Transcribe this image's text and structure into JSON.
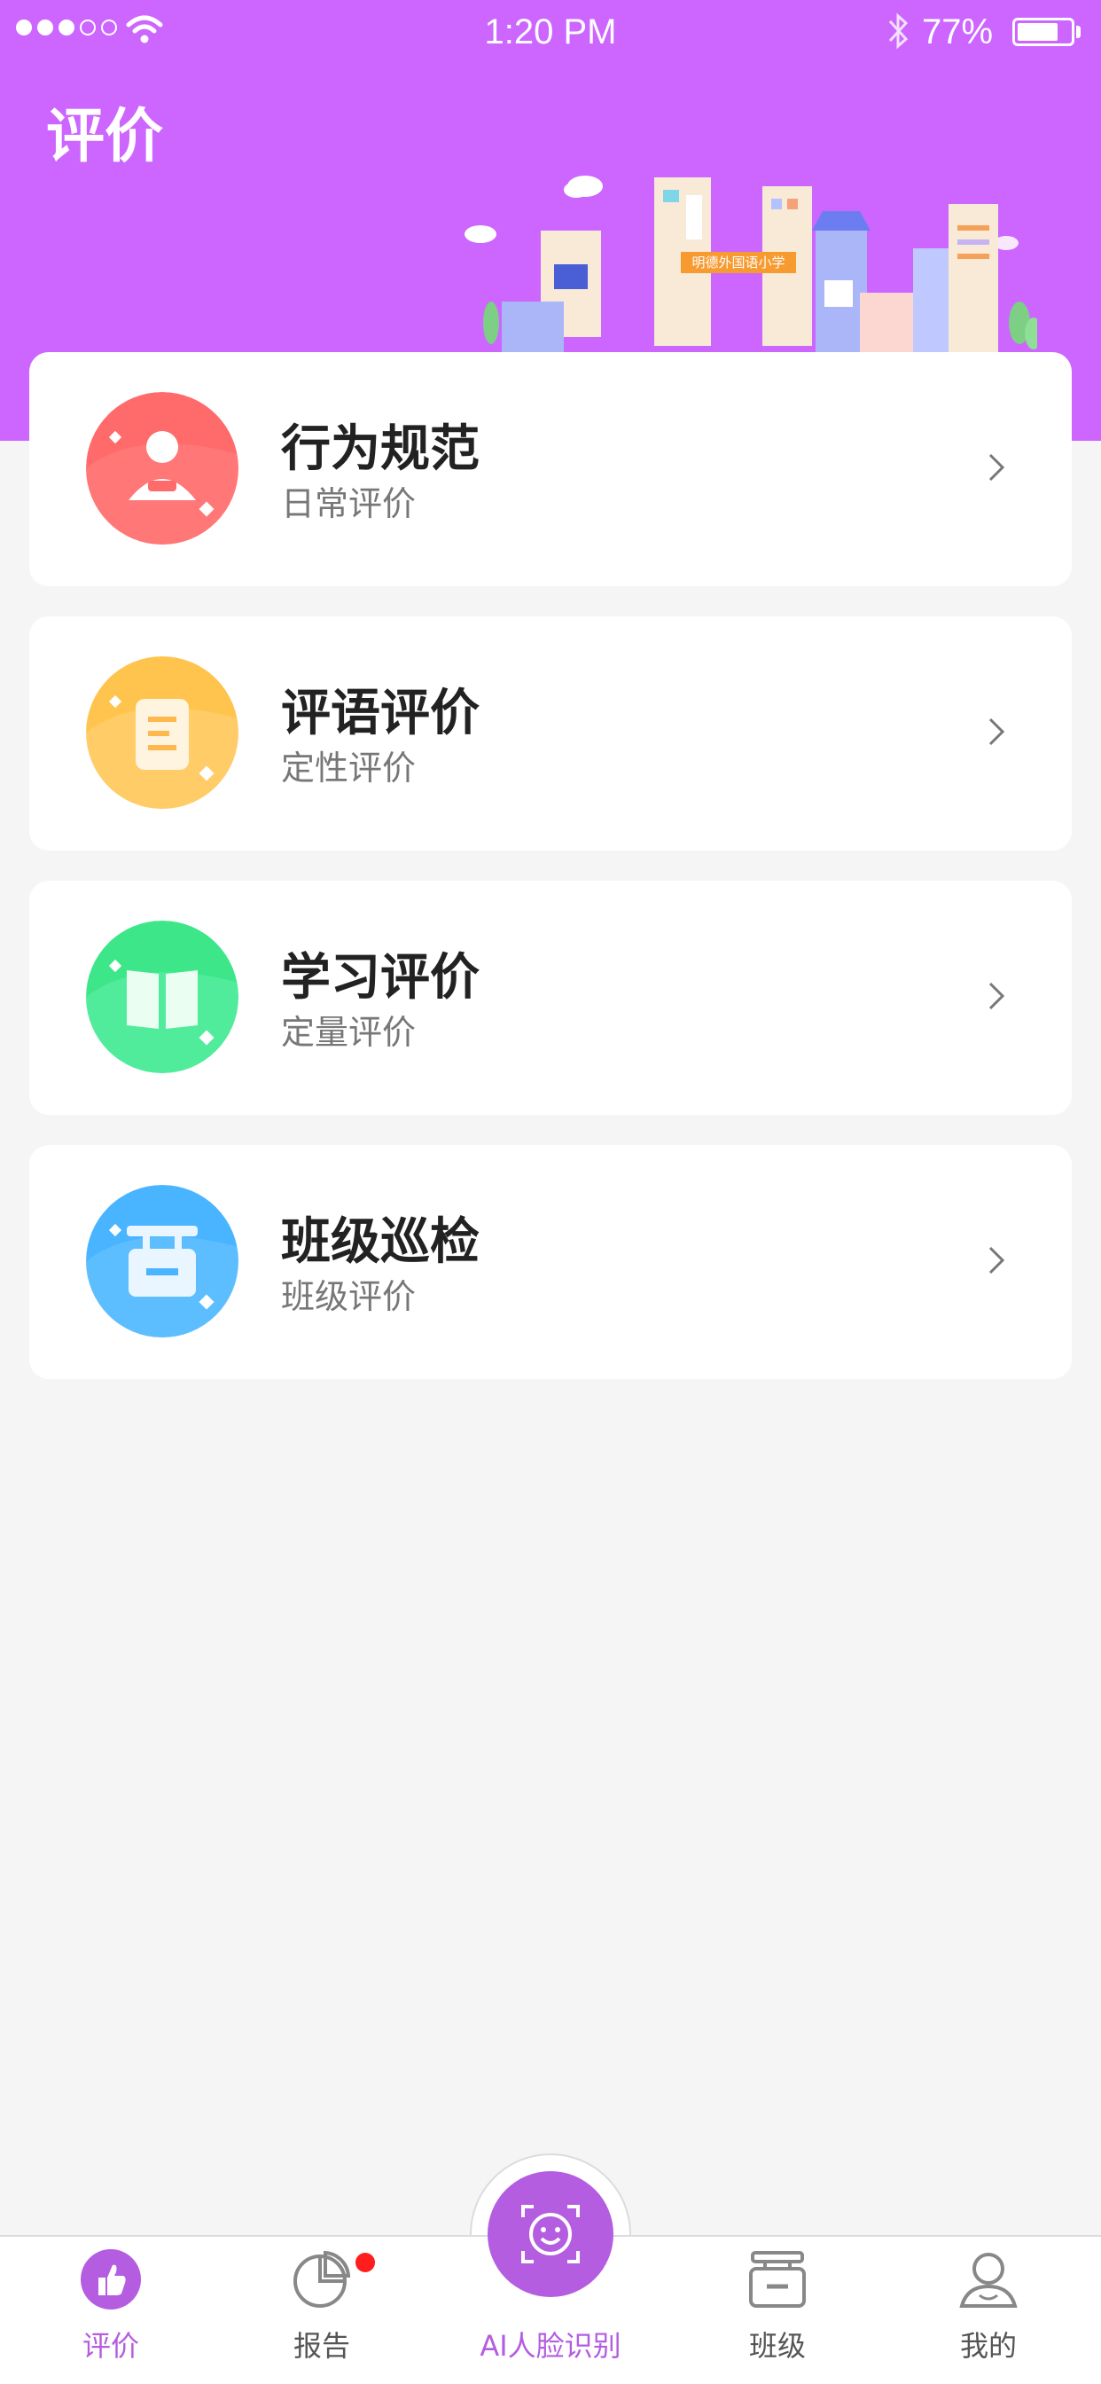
{
  "status_bar": {
    "time": "1:20 PM",
    "battery_percent": "77%",
    "battery_level": 0.77
  },
  "header": {
    "title": "评价",
    "school_sign": "明德外国语小学"
  },
  "cards": [
    {
      "title": "行为规范",
      "subtitle": "日常评价",
      "icon": "person-icon",
      "color": "#ff6b6b"
    },
    {
      "title": "评语评价",
      "subtitle": "定性评价",
      "icon": "document-icon",
      "color": "#ffc44d"
    },
    {
      "title": "学习评价",
      "subtitle": "定量评价",
      "icon": "book-icon",
      "color": "#3ee68a"
    },
    {
      "title": "班级巡检",
      "subtitle": "班级评价",
      "icon": "class-sign-icon",
      "color": "#49b4ff"
    }
  ],
  "tabbar": {
    "items": [
      {
        "label": "评价",
        "icon": "thumbs-up-icon",
        "active": true
      },
      {
        "label": "报告",
        "icon": "pie-chart-icon",
        "badge": true
      },
      {
        "label": "AI人脸识别",
        "icon": "face-scan-icon"
      },
      {
        "label": "班级",
        "icon": "class-sign-icon"
      },
      {
        "label": "我的",
        "icon": "user-icon"
      }
    ]
  },
  "colors": {
    "accent": "#cc66ff",
    "tab_active": "#b45de0",
    "background": "#f5f5f5"
  }
}
